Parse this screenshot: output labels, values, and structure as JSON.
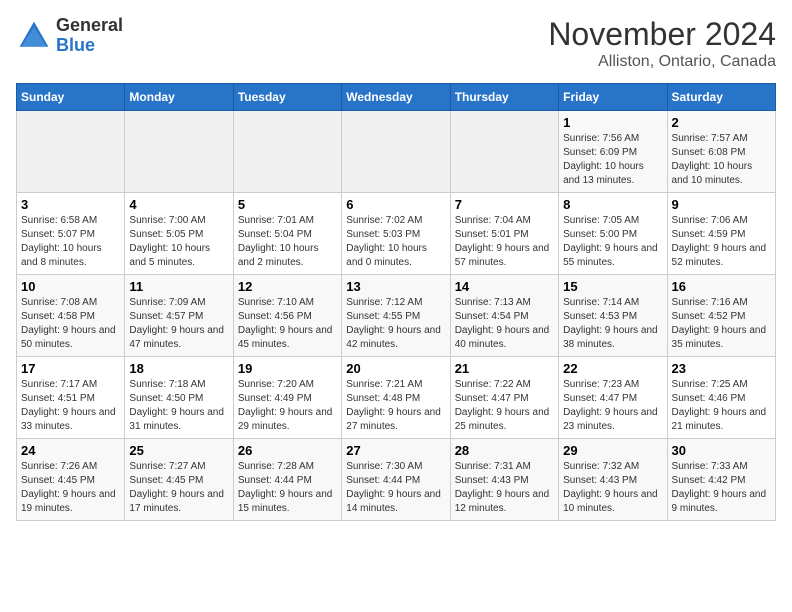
{
  "logo": {
    "line1": "General",
    "line2": "Blue"
  },
  "title": "November 2024",
  "subtitle": "Alliston, Ontario, Canada",
  "days_of_week": [
    "Sunday",
    "Monday",
    "Tuesday",
    "Wednesday",
    "Thursday",
    "Friday",
    "Saturday"
  ],
  "weeks": [
    [
      {
        "day": "",
        "info": ""
      },
      {
        "day": "",
        "info": ""
      },
      {
        "day": "",
        "info": ""
      },
      {
        "day": "",
        "info": ""
      },
      {
        "day": "",
        "info": ""
      },
      {
        "day": "1",
        "info": "Sunrise: 7:56 AM\nSunset: 6:09 PM\nDaylight: 10 hours and 13 minutes."
      },
      {
        "day": "2",
        "info": "Sunrise: 7:57 AM\nSunset: 6:08 PM\nDaylight: 10 hours and 10 minutes."
      }
    ],
    [
      {
        "day": "3",
        "info": "Sunrise: 6:58 AM\nSunset: 5:07 PM\nDaylight: 10 hours and 8 minutes."
      },
      {
        "day": "4",
        "info": "Sunrise: 7:00 AM\nSunset: 5:05 PM\nDaylight: 10 hours and 5 minutes."
      },
      {
        "day": "5",
        "info": "Sunrise: 7:01 AM\nSunset: 5:04 PM\nDaylight: 10 hours and 2 minutes."
      },
      {
        "day": "6",
        "info": "Sunrise: 7:02 AM\nSunset: 5:03 PM\nDaylight: 10 hours and 0 minutes."
      },
      {
        "day": "7",
        "info": "Sunrise: 7:04 AM\nSunset: 5:01 PM\nDaylight: 9 hours and 57 minutes."
      },
      {
        "day": "8",
        "info": "Sunrise: 7:05 AM\nSunset: 5:00 PM\nDaylight: 9 hours and 55 minutes."
      },
      {
        "day": "9",
        "info": "Sunrise: 7:06 AM\nSunset: 4:59 PM\nDaylight: 9 hours and 52 minutes."
      }
    ],
    [
      {
        "day": "10",
        "info": "Sunrise: 7:08 AM\nSunset: 4:58 PM\nDaylight: 9 hours and 50 minutes."
      },
      {
        "day": "11",
        "info": "Sunrise: 7:09 AM\nSunset: 4:57 PM\nDaylight: 9 hours and 47 minutes."
      },
      {
        "day": "12",
        "info": "Sunrise: 7:10 AM\nSunset: 4:56 PM\nDaylight: 9 hours and 45 minutes."
      },
      {
        "day": "13",
        "info": "Sunrise: 7:12 AM\nSunset: 4:55 PM\nDaylight: 9 hours and 42 minutes."
      },
      {
        "day": "14",
        "info": "Sunrise: 7:13 AM\nSunset: 4:54 PM\nDaylight: 9 hours and 40 minutes."
      },
      {
        "day": "15",
        "info": "Sunrise: 7:14 AM\nSunset: 4:53 PM\nDaylight: 9 hours and 38 minutes."
      },
      {
        "day": "16",
        "info": "Sunrise: 7:16 AM\nSunset: 4:52 PM\nDaylight: 9 hours and 35 minutes."
      }
    ],
    [
      {
        "day": "17",
        "info": "Sunrise: 7:17 AM\nSunset: 4:51 PM\nDaylight: 9 hours and 33 minutes."
      },
      {
        "day": "18",
        "info": "Sunrise: 7:18 AM\nSunset: 4:50 PM\nDaylight: 9 hours and 31 minutes."
      },
      {
        "day": "19",
        "info": "Sunrise: 7:20 AM\nSunset: 4:49 PM\nDaylight: 9 hours and 29 minutes."
      },
      {
        "day": "20",
        "info": "Sunrise: 7:21 AM\nSunset: 4:48 PM\nDaylight: 9 hours and 27 minutes."
      },
      {
        "day": "21",
        "info": "Sunrise: 7:22 AM\nSunset: 4:47 PM\nDaylight: 9 hours and 25 minutes."
      },
      {
        "day": "22",
        "info": "Sunrise: 7:23 AM\nSunset: 4:47 PM\nDaylight: 9 hours and 23 minutes."
      },
      {
        "day": "23",
        "info": "Sunrise: 7:25 AM\nSunset: 4:46 PM\nDaylight: 9 hours and 21 minutes."
      }
    ],
    [
      {
        "day": "24",
        "info": "Sunrise: 7:26 AM\nSunset: 4:45 PM\nDaylight: 9 hours and 19 minutes."
      },
      {
        "day": "25",
        "info": "Sunrise: 7:27 AM\nSunset: 4:45 PM\nDaylight: 9 hours and 17 minutes."
      },
      {
        "day": "26",
        "info": "Sunrise: 7:28 AM\nSunset: 4:44 PM\nDaylight: 9 hours and 15 minutes."
      },
      {
        "day": "27",
        "info": "Sunrise: 7:30 AM\nSunset: 4:44 PM\nDaylight: 9 hours and 14 minutes."
      },
      {
        "day": "28",
        "info": "Sunrise: 7:31 AM\nSunset: 4:43 PM\nDaylight: 9 hours and 12 minutes."
      },
      {
        "day": "29",
        "info": "Sunrise: 7:32 AM\nSunset: 4:43 PM\nDaylight: 9 hours and 10 minutes."
      },
      {
        "day": "30",
        "info": "Sunrise: 7:33 AM\nSunset: 4:42 PM\nDaylight: 9 hours and 9 minutes."
      }
    ]
  ]
}
